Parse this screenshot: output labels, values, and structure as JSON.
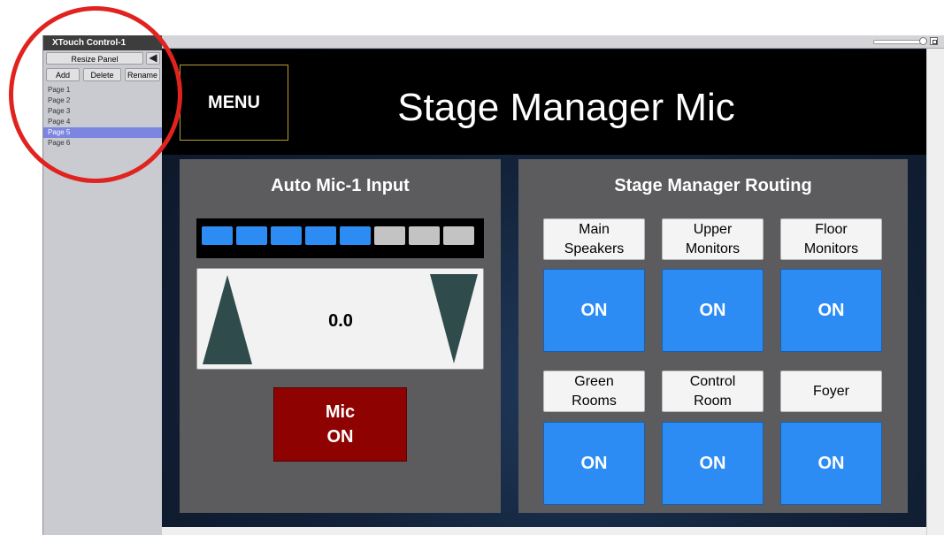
{
  "side_panel": {
    "title": "XTouch Control-1",
    "resize_label": "Resize Panel",
    "add_label": "Add",
    "delete_label": "Delete",
    "rename_label": "Rename",
    "back_icon": "arrow-left-icon",
    "pages": [
      "Page 1",
      "Page 2",
      "Page 3",
      "Page 4",
      "Page 5",
      "Page 6"
    ],
    "selected_page": "Page 5",
    "selected_color": "#7c85e0"
  },
  "annotation": {
    "color": "#e0231f"
  },
  "header": {
    "menu_label": "MENU",
    "title": "Stage Manager Mic"
  },
  "input_panel": {
    "title": "Auto Mic-1 Input",
    "meter": {
      "segments": 8,
      "active": 5,
      "active_color": "#2d8cf4",
      "inactive_color": "#c3c3c3"
    },
    "level_value": "0.0",
    "up_icon": "triangle-up-icon",
    "down_icon": "triangle-down-icon",
    "mic_button": {
      "line1": "Mic",
      "line2": "ON",
      "color": "#8f0202"
    }
  },
  "routing_panel": {
    "title": "Stage Manager Routing",
    "on_color": "#2d8cf4",
    "routes": [
      {
        "line1": "Main",
        "line2": "Speakers",
        "state": "ON"
      },
      {
        "line1": "Upper",
        "line2": "Monitors",
        "state": "ON"
      },
      {
        "line1": "Floor",
        "line2": "Monitors",
        "state": "ON"
      },
      {
        "line1": "Green",
        "line2": "Rooms",
        "state": "ON"
      },
      {
        "line1": "Control",
        "line2": "Room",
        "state": "ON"
      },
      {
        "line1": "Foyer",
        "line2": "",
        "state": "ON"
      }
    ]
  }
}
